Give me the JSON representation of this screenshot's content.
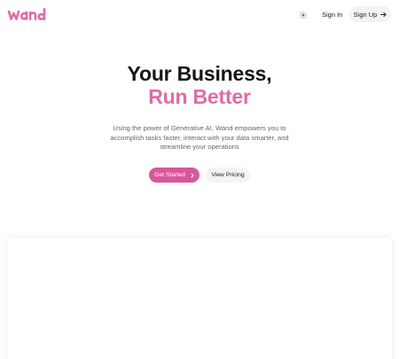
{
  "brand": {
    "logo_text": "wand",
    "accent_color": "#e06ba7"
  },
  "header": {
    "theme_toggle_icon": "sun-icon",
    "signin_label": "Sign In",
    "signup_label": "Sign Up",
    "signup_icon": "arrow-right-icon"
  },
  "hero": {
    "title_line1": "Your Business,",
    "title_line2": "Run Better",
    "description": "Using the power of Generative AI, Wand empowers you to accomplish tasks faster, interact with your data smarter, and streamline your operations",
    "primary_cta": "Get Started",
    "primary_cta_icon": "chevron-right-icon",
    "secondary_cta": "View Pricing"
  }
}
